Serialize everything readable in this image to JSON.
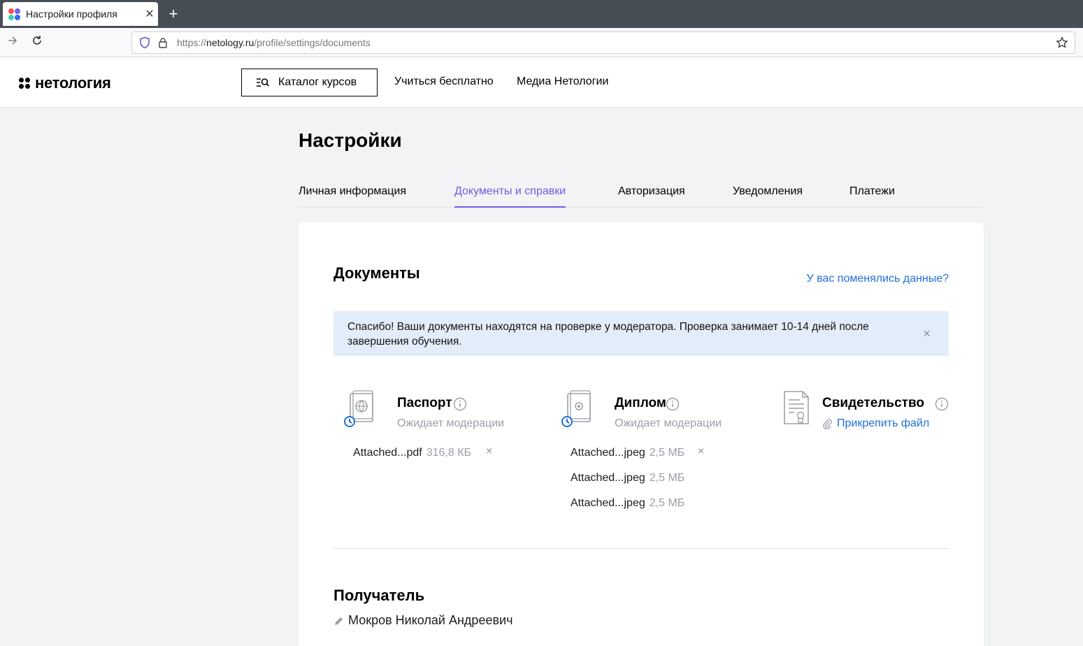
{
  "browser": {
    "tab_title": "Настройки профиля",
    "tab_close": "✕",
    "new_tab": "+",
    "url_scheme": "https://",
    "url_domain": "netology.ru",
    "url_path": "/profile/settings/documents"
  },
  "header": {
    "logo_text": "нетология",
    "catalog_label": "Каталог курсов",
    "links": [
      "Учиться бесплатно",
      "Медиа Нетологии"
    ]
  },
  "page": {
    "title": "Настройки",
    "tabs": [
      {
        "label": "Личная информация",
        "active": false
      },
      {
        "label": "Документы и справки",
        "active": true
      },
      {
        "label": "Авторизация",
        "active": false
      },
      {
        "label": "Уведомления",
        "active": false
      },
      {
        "label": "Платежи",
        "active": false
      }
    ],
    "accent_color": "#6f5ce0",
    "link_color": "#1f6fd6"
  },
  "documents": {
    "title": "Документы",
    "change_link": "У вас поменялись данные?",
    "notice": "Спасибо! Ваши документы находятся на проверке у модератора. Проверка занимает 10-14 дней после завершения обучения.",
    "notice_close": "×",
    "items": [
      {
        "name": "Паспорт",
        "status": "Ожидает модерации",
        "files": [
          {
            "name": "Attached...pdf",
            "size": "316,8 КБ",
            "removable": true
          }
        ]
      },
      {
        "name": "Диплом",
        "status": "Ожидает модерации",
        "files": [
          {
            "name": "Attached...jpeg",
            "size": "2,5 МБ",
            "removable": true
          },
          {
            "name": "Attached...jpeg",
            "size": "2,5 МБ",
            "removable": false
          },
          {
            "name": "Attached...jpeg",
            "size": "2,5 МБ",
            "removable": false
          }
        ]
      },
      {
        "name": "Свидетельство",
        "attach_label": "Прикрепить файл",
        "files": []
      }
    ],
    "file_delete_glyph": "×"
  },
  "recipient": {
    "title": "Получатель",
    "name": "Мокров Николай Андреевич"
  }
}
